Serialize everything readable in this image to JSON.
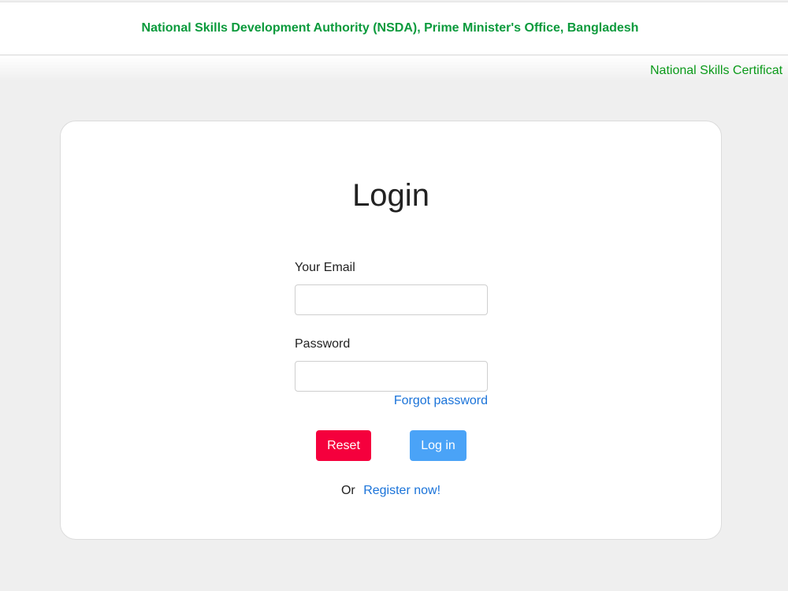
{
  "header": {
    "title": "National Skills Development Authority (NSDA), Prime Minister's Office, Bangladesh"
  },
  "ticker": {
    "text": "National Skills Certificat"
  },
  "login": {
    "title": "Login",
    "email_label": "Your Email",
    "email_value": "",
    "password_label": "Password",
    "password_value": "",
    "forgot_label": "Forgot password",
    "reset_label": "Reset",
    "login_label": "Log in",
    "or_text": "Or",
    "register_label": "Register now!"
  },
  "colors": {
    "header_text": "#0b9a3c",
    "link": "#1a73d9",
    "reset_button": "#f5003d",
    "login_button": "#4aa3f7",
    "page_background": "#efefef"
  }
}
